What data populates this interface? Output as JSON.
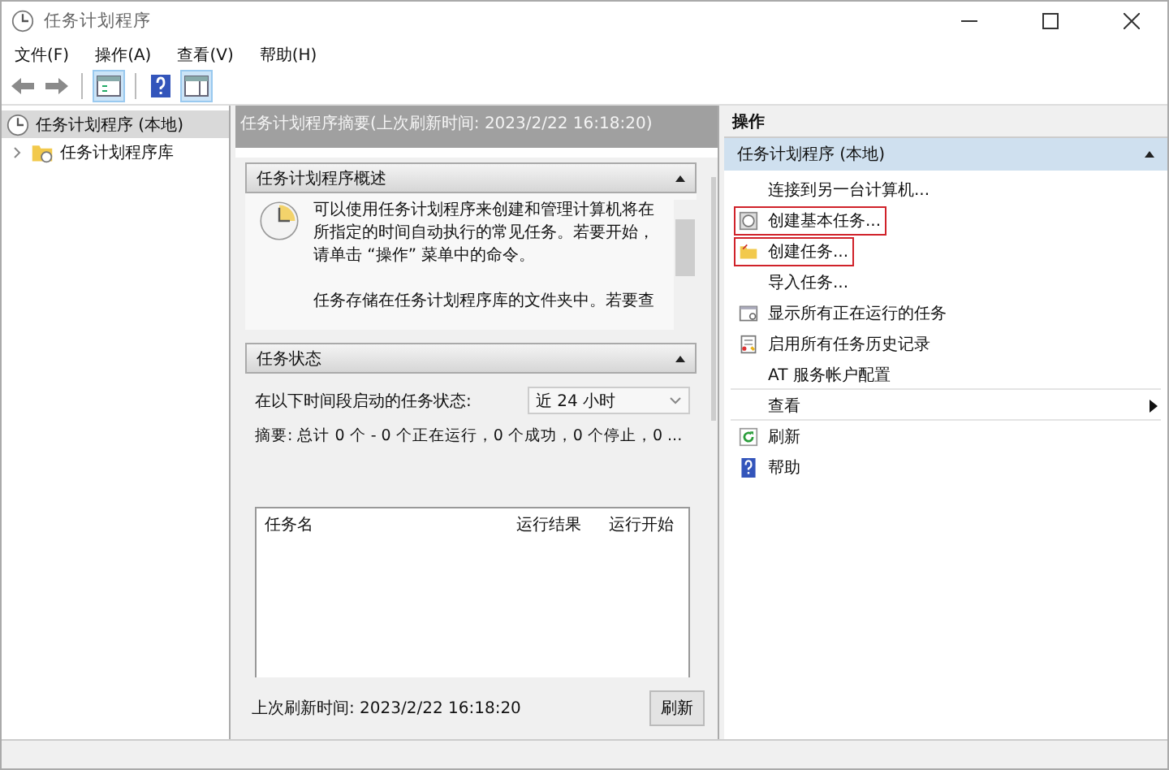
{
  "window": {
    "title": "任务计划程序"
  },
  "menu": [
    "文件(F)",
    "操作(A)",
    "查看(V)",
    "帮助(H)"
  ],
  "tree": [
    {
      "label": "任务计划程序 (本地)",
      "selected": true,
      "children": [
        {
          "label": "任务计划程序库",
          "expanded": false
        }
      ]
    }
  ],
  "summary": {
    "title": "任务计划程序摘要(上次刷新时间: 2023/2/22 16:18:20)",
    "overview": {
      "title": "任务计划程序概述",
      "paragraphs": [
        "可以使用任务计划程序来创建和管理计算机将在所指定的时间自动执行的常见任务。若要开始，请单击 “操作” 菜单中的命令。",
        "任务存储在任务计划程序库的文件夹中。若要查"
      ]
    },
    "status": {
      "title": "任务状态",
      "period_label": "在以下时间段启动的任务状态:",
      "period_value": "近 24 小时",
      "summary_line": "摘要: 总计 0 个 - 0 个正在运行，0 个成功，0 个停止，0 ...",
      "columns": [
        "任务名",
        "运行结果",
        "运行开始"
      ]
    },
    "last_refresh": "上次刷新时间: 2023/2/22 16:18:20",
    "refresh_button": "刷新"
  },
  "actions": {
    "title": "操作",
    "group": "任务计划程序 (本地)",
    "items": [
      {
        "label": "连接到另一台计算机...",
        "kind": "plain",
        "highlighted": false
      },
      {
        "label": "创建基本任务...",
        "kind": "wizard",
        "highlighted": true
      },
      {
        "label": "创建任务...",
        "kind": "folder",
        "highlighted": true
      },
      {
        "label": "导入任务...",
        "kind": "plain",
        "highlighted": false
      },
      {
        "label": "显示所有正在运行的任务",
        "kind": "window",
        "highlighted": false
      },
      {
        "label": "启用所有任务历史记录",
        "kind": "log",
        "highlighted": false
      },
      {
        "label": "AT 服务帐户配置",
        "kind": "plain",
        "highlighted": false
      },
      {
        "label": "查看",
        "kind": "plain",
        "highlighted": false,
        "submenu": true
      },
      {
        "label": "刷新",
        "kind": "refresh",
        "highlighted": false
      },
      {
        "label": "帮助",
        "kind": "help",
        "highlighted": false
      }
    ]
  }
}
